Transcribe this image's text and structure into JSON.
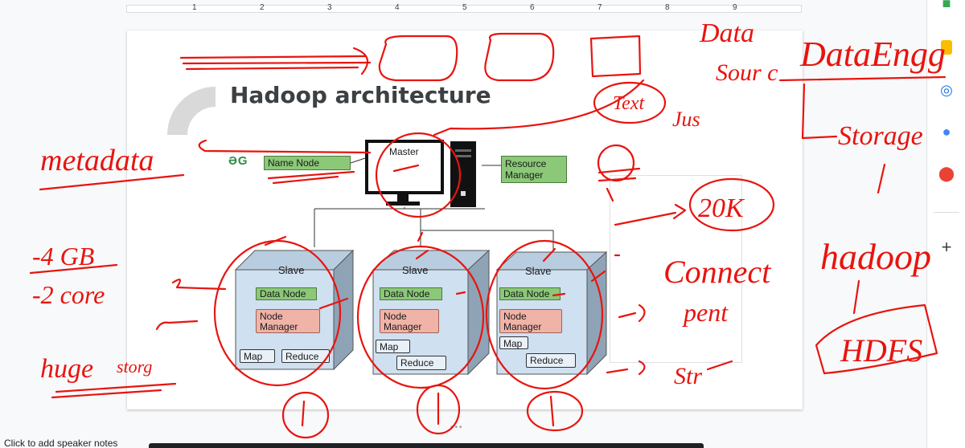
{
  "ruler": {
    "numbers": [
      "1",
      "2",
      "3",
      "4",
      "5",
      "6",
      "7",
      "8",
      "9"
    ]
  },
  "slide": {
    "title": "Hadoop architecture",
    "logo_text": "ƏG",
    "name_node": "Name Node",
    "master": "Master",
    "resource_manager": "Resource Manager",
    "slaves": [
      {
        "label": "Slave",
        "data_node": "Data Node",
        "node_manager": "Node Manager",
        "map": "Map",
        "reduce": "Reduce"
      },
      {
        "label": "Slave",
        "data_node": "Data Node",
        "node_manager": "Node Manager",
        "map": "Map",
        "reduce": "Reduce"
      },
      {
        "label": "Slave",
        "data_node": "Data Node",
        "node_manager": "Node Manager",
        "map": "Map",
        "reduce": "Reduce"
      }
    ]
  },
  "speaker_notes": "Click to add speaker notes",
  "annotations": {
    "ink_color": "#e8140f",
    "notes": [
      "Data",
      "Sour c",
      "Data Engg",
      "Text",
      "Jus",
      "metadata",
      "1",
      "20K",
      "Connect",
      "pent",
      "Str",
      "storage",
      "hadoop",
      "HDFS",
      "4 GB",
      "2 core",
      "huge",
      "storg"
    ]
  },
  "side_panel": {
    "icons": [
      "keep-icon",
      "tasks-icon",
      "contacts-icon",
      "maps-icon",
      "add-icon"
    ]
  }
}
